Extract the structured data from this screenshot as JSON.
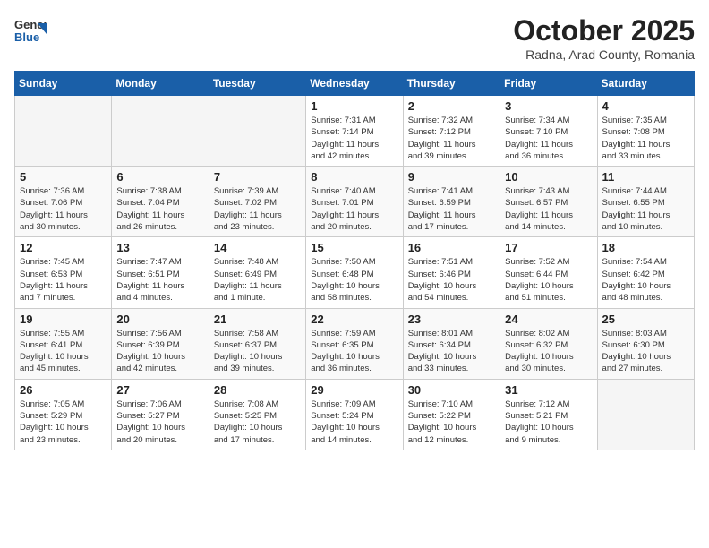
{
  "header": {
    "logo_general": "General",
    "logo_blue": "Blue",
    "month": "October 2025",
    "location": "Radna, Arad County, Romania"
  },
  "weekdays": [
    "Sunday",
    "Monday",
    "Tuesday",
    "Wednesday",
    "Thursday",
    "Friday",
    "Saturday"
  ],
  "weeks": [
    [
      {
        "day": "",
        "info": ""
      },
      {
        "day": "",
        "info": ""
      },
      {
        "day": "",
        "info": ""
      },
      {
        "day": "1",
        "info": "Sunrise: 7:31 AM\nSunset: 7:14 PM\nDaylight: 11 hours\nand 42 minutes."
      },
      {
        "day": "2",
        "info": "Sunrise: 7:32 AM\nSunset: 7:12 PM\nDaylight: 11 hours\nand 39 minutes."
      },
      {
        "day": "3",
        "info": "Sunrise: 7:34 AM\nSunset: 7:10 PM\nDaylight: 11 hours\nand 36 minutes."
      },
      {
        "day": "4",
        "info": "Sunrise: 7:35 AM\nSunset: 7:08 PM\nDaylight: 11 hours\nand 33 minutes."
      }
    ],
    [
      {
        "day": "5",
        "info": "Sunrise: 7:36 AM\nSunset: 7:06 PM\nDaylight: 11 hours\nand 30 minutes."
      },
      {
        "day": "6",
        "info": "Sunrise: 7:38 AM\nSunset: 7:04 PM\nDaylight: 11 hours\nand 26 minutes."
      },
      {
        "day": "7",
        "info": "Sunrise: 7:39 AM\nSunset: 7:02 PM\nDaylight: 11 hours\nand 23 minutes."
      },
      {
        "day": "8",
        "info": "Sunrise: 7:40 AM\nSunset: 7:01 PM\nDaylight: 11 hours\nand 20 minutes."
      },
      {
        "day": "9",
        "info": "Sunrise: 7:41 AM\nSunset: 6:59 PM\nDaylight: 11 hours\nand 17 minutes."
      },
      {
        "day": "10",
        "info": "Sunrise: 7:43 AM\nSunset: 6:57 PM\nDaylight: 11 hours\nand 14 minutes."
      },
      {
        "day": "11",
        "info": "Sunrise: 7:44 AM\nSunset: 6:55 PM\nDaylight: 11 hours\nand 10 minutes."
      }
    ],
    [
      {
        "day": "12",
        "info": "Sunrise: 7:45 AM\nSunset: 6:53 PM\nDaylight: 11 hours\nand 7 minutes."
      },
      {
        "day": "13",
        "info": "Sunrise: 7:47 AM\nSunset: 6:51 PM\nDaylight: 11 hours\nand 4 minutes."
      },
      {
        "day": "14",
        "info": "Sunrise: 7:48 AM\nSunset: 6:49 PM\nDaylight: 11 hours\nand 1 minute."
      },
      {
        "day": "15",
        "info": "Sunrise: 7:50 AM\nSunset: 6:48 PM\nDaylight: 10 hours\nand 58 minutes."
      },
      {
        "day": "16",
        "info": "Sunrise: 7:51 AM\nSunset: 6:46 PM\nDaylight: 10 hours\nand 54 minutes."
      },
      {
        "day": "17",
        "info": "Sunrise: 7:52 AM\nSunset: 6:44 PM\nDaylight: 10 hours\nand 51 minutes."
      },
      {
        "day": "18",
        "info": "Sunrise: 7:54 AM\nSunset: 6:42 PM\nDaylight: 10 hours\nand 48 minutes."
      }
    ],
    [
      {
        "day": "19",
        "info": "Sunrise: 7:55 AM\nSunset: 6:41 PM\nDaylight: 10 hours\nand 45 minutes."
      },
      {
        "day": "20",
        "info": "Sunrise: 7:56 AM\nSunset: 6:39 PM\nDaylight: 10 hours\nand 42 minutes."
      },
      {
        "day": "21",
        "info": "Sunrise: 7:58 AM\nSunset: 6:37 PM\nDaylight: 10 hours\nand 39 minutes."
      },
      {
        "day": "22",
        "info": "Sunrise: 7:59 AM\nSunset: 6:35 PM\nDaylight: 10 hours\nand 36 minutes."
      },
      {
        "day": "23",
        "info": "Sunrise: 8:01 AM\nSunset: 6:34 PM\nDaylight: 10 hours\nand 33 minutes."
      },
      {
        "day": "24",
        "info": "Sunrise: 8:02 AM\nSunset: 6:32 PM\nDaylight: 10 hours\nand 30 minutes."
      },
      {
        "day": "25",
        "info": "Sunrise: 8:03 AM\nSunset: 6:30 PM\nDaylight: 10 hours\nand 27 minutes."
      }
    ],
    [
      {
        "day": "26",
        "info": "Sunrise: 7:05 AM\nSunset: 5:29 PM\nDaylight: 10 hours\nand 23 minutes."
      },
      {
        "day": "27",
        "info": "Sunrise: 7:06 AM\nSunset: 5:27 PM\nDaylight: 10 hours\nand 20 minutes."
      },
      {
        "day": "28",
        "info": "Sunrise: 7:08 AM\nSunset: 5:25 PM\nDaylight: 10 hours\nand 17 minutes."
      },
      {
        "day": "29",
        "info": "Sunrise: 7:09 AM\nSunset: 5:24 PM\nDaylight: 10 hours\nand 14 minutes."
      },
      {
        "day": "30",
        "info": "Sunrise: 7:10 AM\nSunset: 5:22 PM\nDaylight: 10 hours\nand 12 minutes."
      },
      {
        "day": "31",
        "info": "Sunrise: 7:12 AM\nSunset: 5:21 PM\nDaylight: 10 hours\nand 9 minutes."
      },
      {
        "day": "",
        "info": ""
      }
    ]
  ]
}
